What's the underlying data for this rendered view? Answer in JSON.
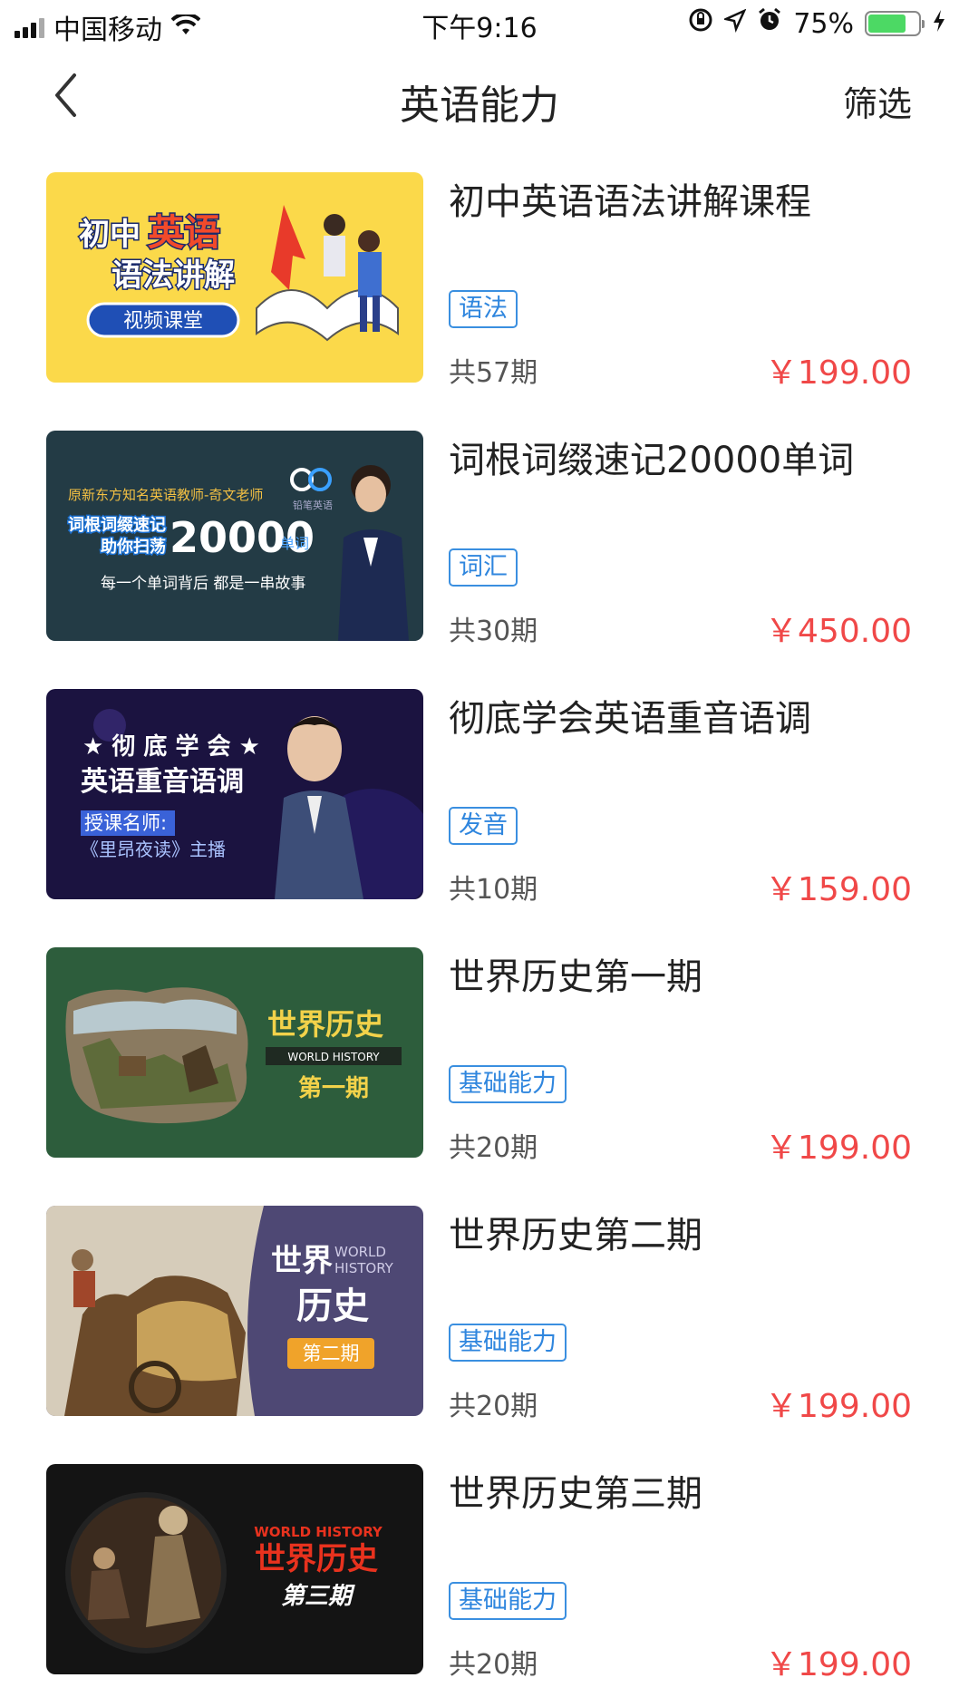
{
  "status_bar": {
    "carrier": "中国移动",
    "time": "下午9:16",
    "battery_percent": "75%",
    "battery_level": 0.75
  },
  "nav": {
    "title": "英语能力",
    "filter_label": "筛选"
  },
  "courses": [
    {
      "title": "初中英语语法讲解课程",
      "tag": "语法",
      "count": "共57期",
      "price": "￥199.00",
      "cover": {
        "line1a": "初中",
        "line1b": "英语",
        "line2": "语法讲解",
        "pill": "视频课堂"
      }
    },
    {
      "title": "词根词缀速记20000单词",
      "tag": "词汇",
      "count": "共30期",
      "price": "￥450.00",
      "cover": {
        "top": "原新东方知名英语教师-奇文老师",
        "left1": "词根词缀速记",
        "left2": "助你扫荡",
        "big": "20000",
        "unit": "单词",
        "bottom": "每一个单词背后 都是一串故事",
        "brand": "铅笔英语"
      }
    },
    {
      "title": "彻底学会英语重音语调",
      "tag": "发音",
      "count": "共10期",
      "price": "￥159.00",
      "cover": {
        "line1": "★ 彻 底 学 会 ★",
        "line2": "英语重音语调",
        "line3": "授课名师:",
        "line4": "《里昂夜读》主播"
      }
    },
    {
      "title": "世界历史第一期",
      "tag": "基础能力",
      "count": "共20期",
      "price": "￥199.00",
      "cover": {
        "big": "世界历史",
        "band": "WORLD HISTORY",
        "sub": "第一期"
      }
    },
    {
      "title": "世界历史第二期",
      "tag": "基础能力",
      "count": "共20期",
      "price": "￥199.00",
      "cover": {
        "big1": "世界",
        "big2": "历史",
        "en1": "WORLD",
        "en2": "HISTORY",
        "pill": "第二期"
      }
    },
    {
      "title": "世界历史第三期",
      "tag": "基础能力",
      "count": "共20期",
      "price": "￥199.00",
      "cover": {
        "en": "WORLD HISTORY",
        "big": "世界历史",
        "sub": "第三期"
      }
    }
  ],
  "colors": {
    "tag_blue": "#2f86de",
    "price_red": "#f04848"
  }
}
